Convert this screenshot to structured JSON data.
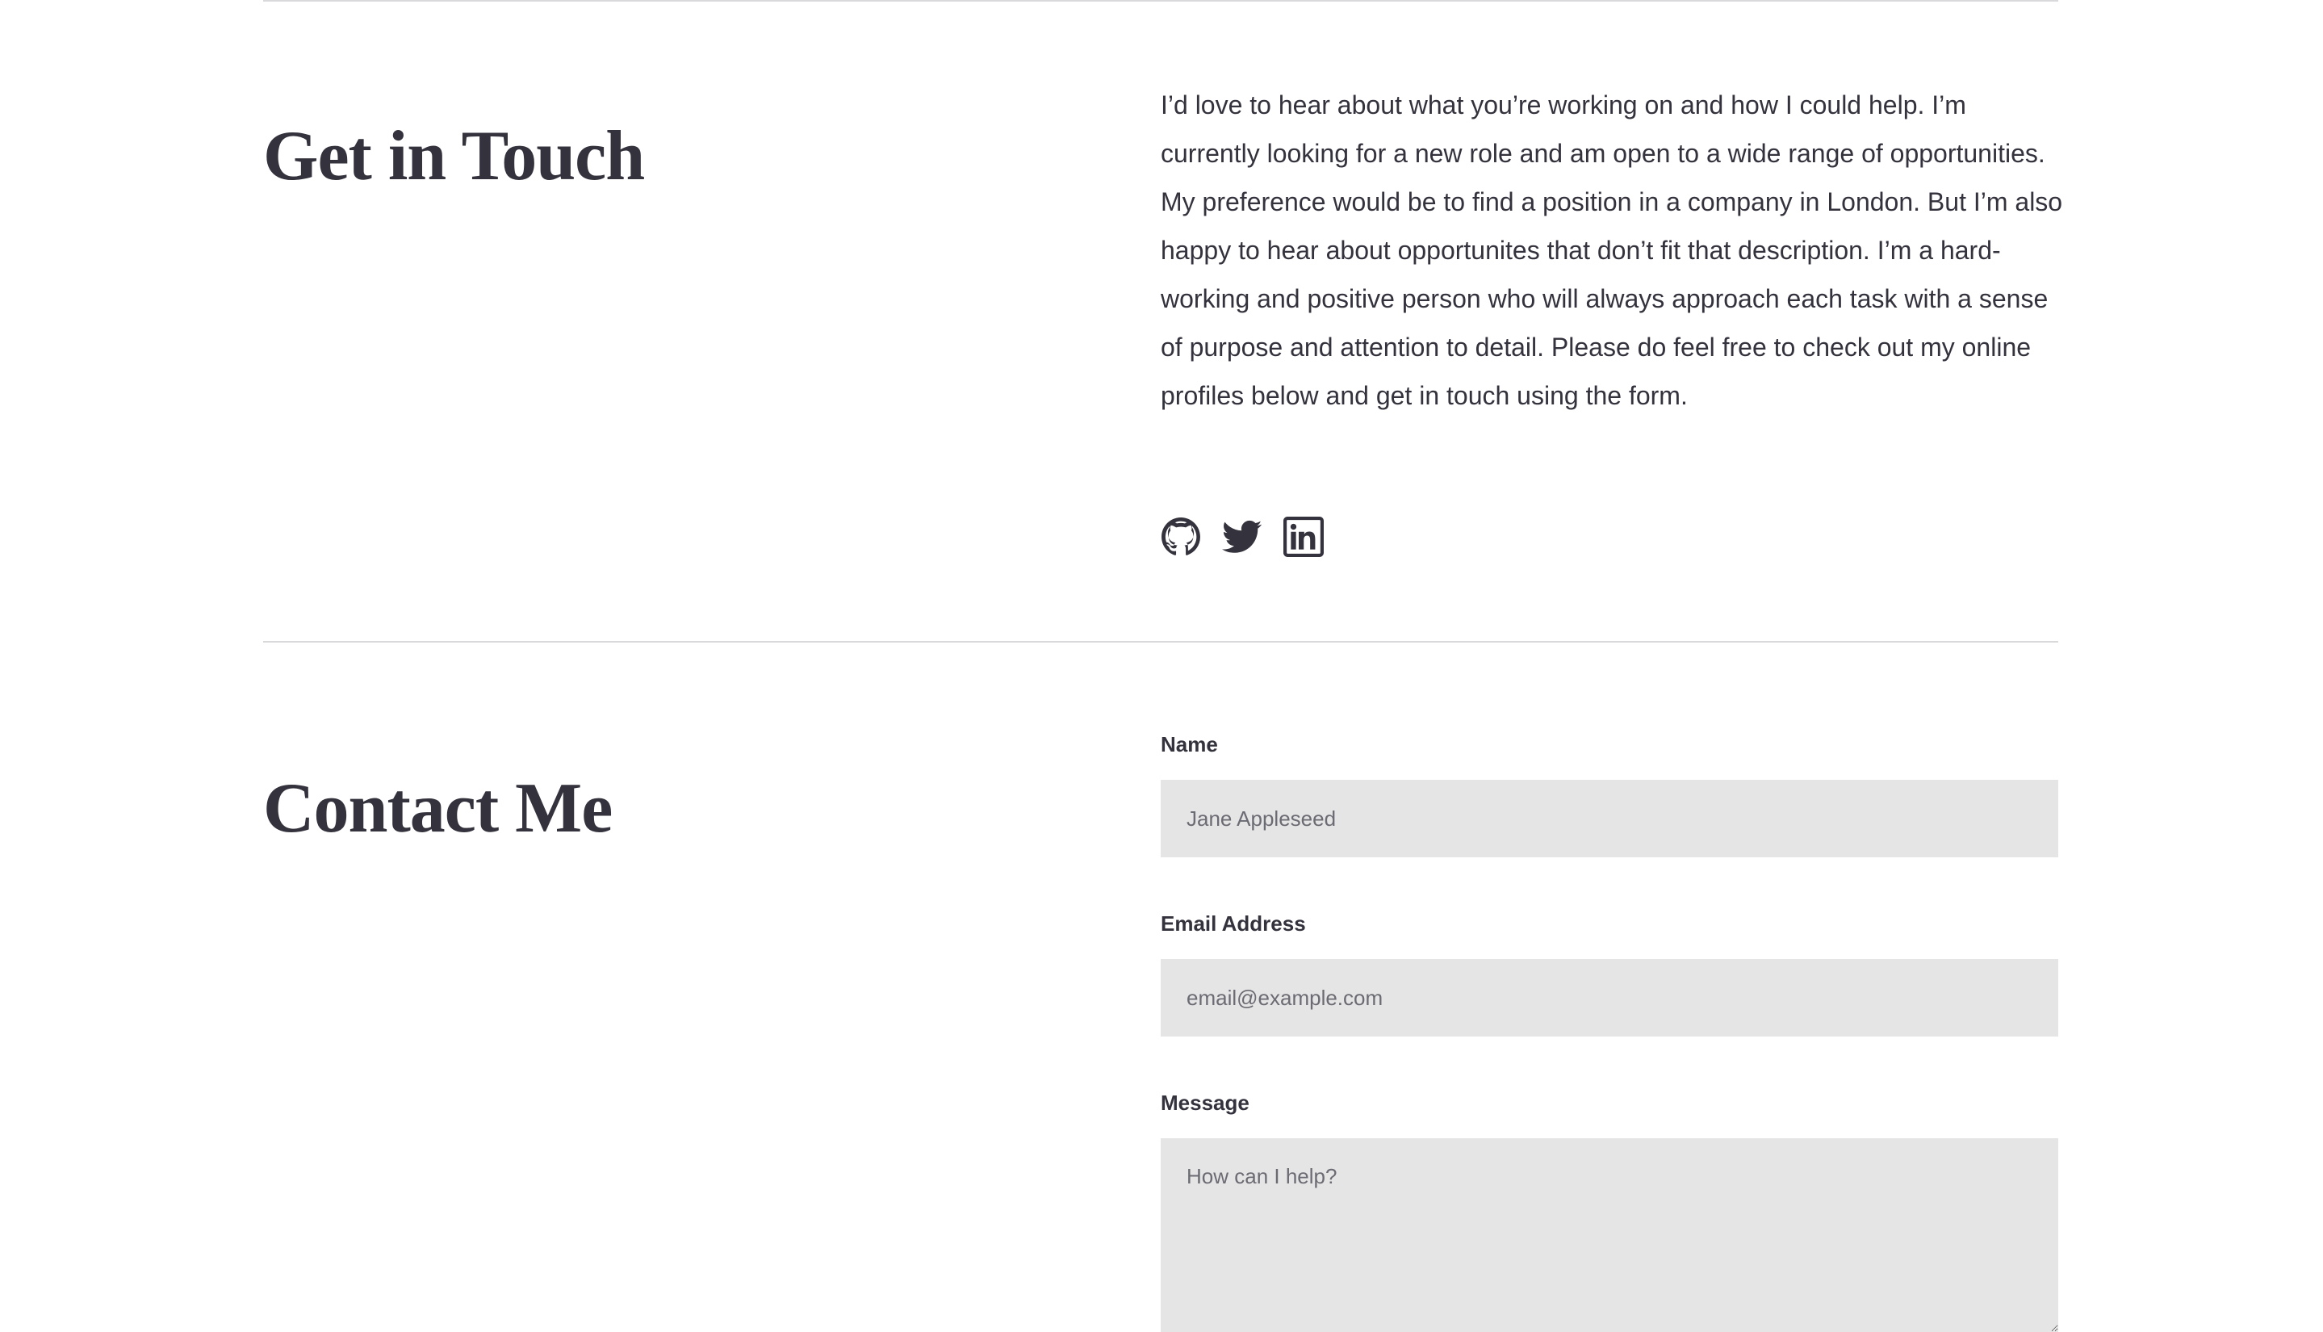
{
  "about": {
    "title": "Get in Touch",
    "body": "I’d love to hear about what you’re working on and how I could help. I’m currently looking for a new role and am open to a wide range of opportunities. My preference would be to find a position in a company in London. But I’m also happy to hear about opportunites that don’t fit that description. I’m a hard-working and positive person who will always approach each task with a sense of purpose and attention to detail. Please do feel free to check out my online profiles below and get in touch using the form.",
    "socials": [
      {
        "icon": "github-icon"
      },
      {
        "icon": "twitter-icon"
      },
      {
        "icon": "linkedin-icon"
      }
    ]
  },
  "contact": {
    "title": "Contact Me",
    "name": {
      "label": "Name",
      "placeholder": "Jane Appleseed",
      "value": ""
    },
    "email": {
      "label": "Email Address",
      "placeholder": "email@example.com",
      "value": ""
    },
    "message": {
      "label": "Message",
      "placeholder": "How can I help?",
      "value": ""
    }
  },
  "colors": {
    "text": "#33323d",
    "field_bg": "#e5e5e5",
    "divider": "#d9d9dc",
    "background": "#ffffff"
  }
}
